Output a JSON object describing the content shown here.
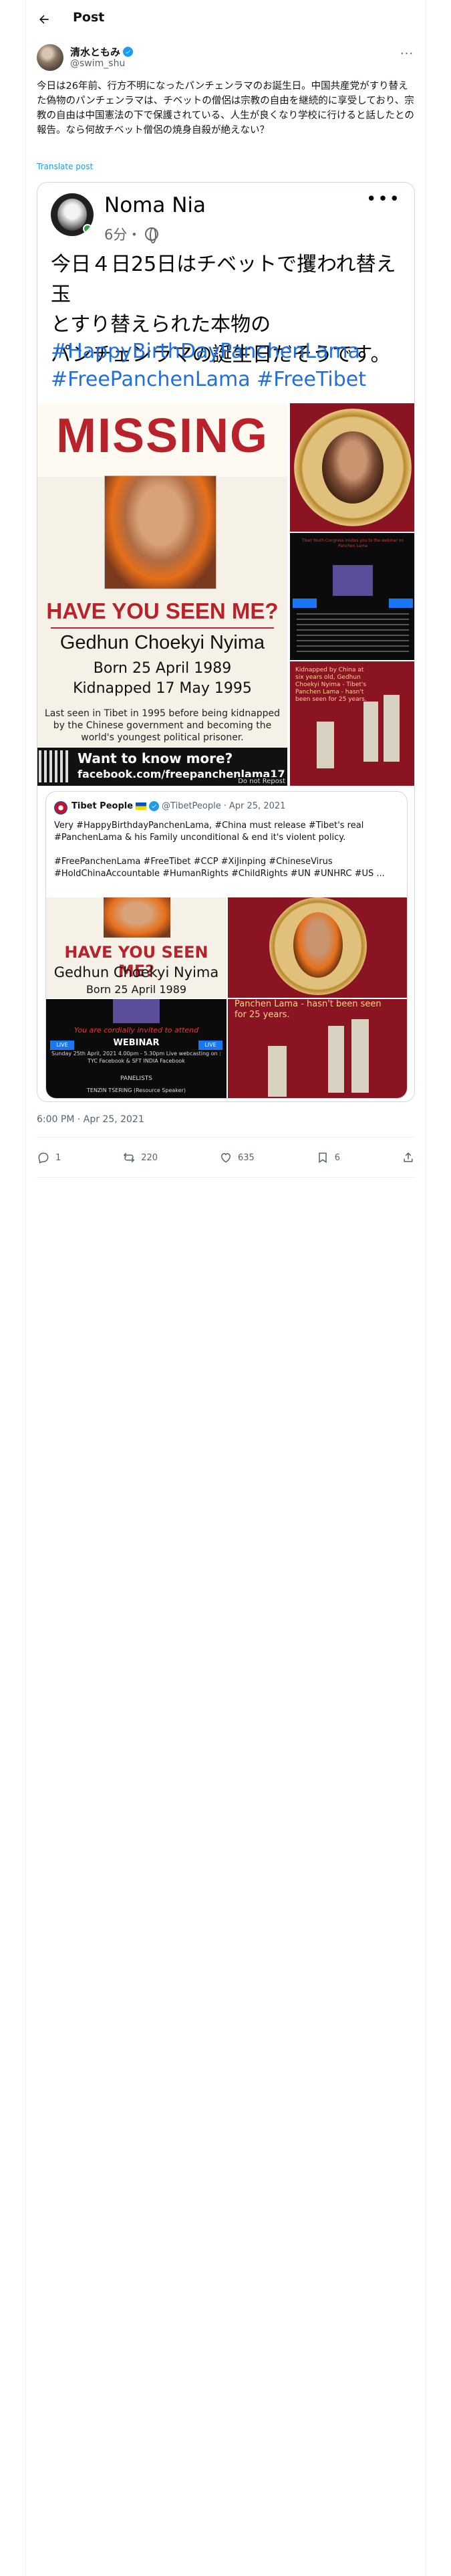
{
  "header": {
    "title": "Post"
  },
  "author": {
    "display_name": "清水ともみ",
    "handle": "@swim_shu"
  },
  "tweet": {
    "text": "今日は26年前、行方不明になったパンチェンラマのお誕生日。中国共産党がすり替えた偽物のパンチェンラマは、チベットの僧侶は宗教の自由を継続的に享受しており、宗教の自由は中国憲法の下で保護されている、人生が良くなり学校に行けると話したとの報告。なら何故チベット僧侶の焼身自殺が絶えない？",
    "translate_label": "Translate post"
  },
  "fb_post": {
    "name": "Noma Nia",
    "time": "6分・",
    "body_line1": "今日４日25日はチベットで攫われ替え玉",
    "body_line2": "とすり替えられた本物の",
    "body_line3": "パンチェンラマの誕生日だそうです。",
    "tags_line1": "#HappyBirthDayPanchenLama",
    "tags_line2": "#FreePanchenLama #FreeTibet"
  },
  "poster": {
    "missing": "MISSING",
    "have_you_seen": "HAVE YOU SEEN ME?",
    "name": "Gedhun Choekyi Nyima",
    "born": "Born 25 April 1989",
    "kidnapped": "Kidnapped 17 May 1995",
    "last_seen": "Last seen in Tibet in 1995 before being kidnapped by the Chinese government and becoming the world's youngest political prisoner.",
    "want_to_know": "Want to know more?",
    "url": "facebook.com/freepanchenlama17",
    "do_not": "Do not Repost"
  },
  "side_images": {
    "illus_text": "Kidnapped by China at six years old, Gedhun Choekyi Nyima - Tibet's Panchen Lama - hasn't been seen for 25 years.",
    "webinar_text": "Tibet Youth Congress invites you to the webinar on Panchen Lama"
  },
  "quoted": {
    "name": "Tibet People",
    "handle": "@TibetPeople",
    "date": "Apr 25, 2021",
    "text1": "Very #HappyBirthdayPanchenLama, #China must release #Tibet's real #PanchenLama & his Family unconditional & end it's violent policy.",
    "text2": "#FreePanchenLama #FreeTibet #CCP #XiJinping #ChineseVirus #HoldChinaAccountable #HumanRights #ChildRights #UN #UNHRC #US ...",
    "img1_h1": "HAVE YOU SEEN ME?",
    "img1_h2": "Gedhun Choekyi Nyima",
    "img1_h3": "Born 25 April 1989",
    "img3_t1": "You are cordially invited to attend",
    "img3_t2": "WEBINAR",
    "img3_t3": "Sunday 25th April, 2021 4.00pm - 5.30pm\nLive webcasting on : TYC Facebook & SFT INDIA Facebook",
    "img3_t4": "PANELISTS",
    "img3_t5": "TENZIN TSERING (Resource Speaker)",
    "img3_live": "LIVE",
    "img4_t1": "Panchen Lama - hasn't been seen",
    "img4_t2": "for 25 years."
  },
  "timestamp": "6:00 PM · Apr 25, 2021",
  "actions": {
    "replies": "1",
    "reposts": "220",
    "likes": "635",
    "bookmarks": "6"
  },
  "colors": {
    "accent": "#1d9bf0",
    "text": "#0f1419",
    "muted": "#536471",
    "poster_red": "#b8232b"
  }
}
